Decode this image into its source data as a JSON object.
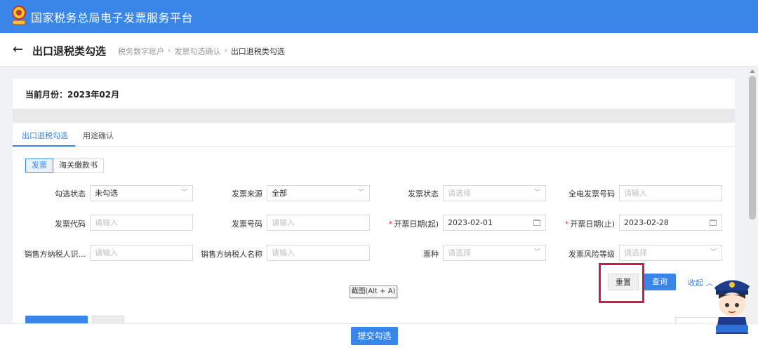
{
  "topbar": {
    "platform_title": "国家税务总局电子发票服务平台",
    "emblem_icon": "tax-emblem-icon"
  },
  "header": {
    "page_title": "出口退税类勾选",
    "breadcrumb": [
      "税务数字账户",
      "发票勾选确认",
      "出口退税类勾选"
    ]
  },
  "month": {
    "label": "当前月份：2023年02月"
  },
  "tabs": [
    {
      "label": "出口退税勾选",
      "active": true
    },
    {
      "label": "用途确认",
      "active": false
    }
  ],
  "segments": [
    {
      "label": "发票",
      "active": true
    },
    {
      "label": "海关缴款书",
      "active": false
    }
  ],
  "form": {
    "check_status": {
      "label": "勾选状态",
      "value": "未勾选"
    },
    "invoice_source": {
      "label": "发票来源",
      "value": "全部"
    },
    "invoice_status": {
      "label": "发票状态",
      "placeholder": "请选择"
    },
    "full_elec_no": {
      "label": "全电发票号码",
      "placeholder": "请输入"
    },
    "invoice_code": {
      "label": "发票代码",
      "placeholder": "请输入"
    },
    "invoice_no": {
      "label": "发票号码",
      "placeholder": "请输入"
    },
    "date_start": {
      "label": "开票日期(起)",
      "value": "2023-02-01"
    },
    "date_end": {
      "label": "开票日期(止)",
      "value": "2023-02-28"
    },
    "seller_tax_id": {
      "label": "销售方纳税人识...",
      "placeholder": "请输入"
    },
    "seller_name": {
      "label": "销售方纳税人名称",
      "placeholder": "请输入"
    },
    "ticket_type": {
      "label": "票种",
      "placeholder": "请选择"
    },
    "risk_level": {
      "label": "发票风险等级",
      "placeholder": "请选择"
    }
  },
  "actions": {
    "reset": "重置",
    "query": "查询",
    "collapse": "收起",
    "submit": "提交勾选"
  },
  "tooltip": "截图(Alt + A)",
  "colors": {
    "primary": "#3a86e8",
    "highlight": "#d01a4a",
    "required": "#e03c3c"
  }
}
